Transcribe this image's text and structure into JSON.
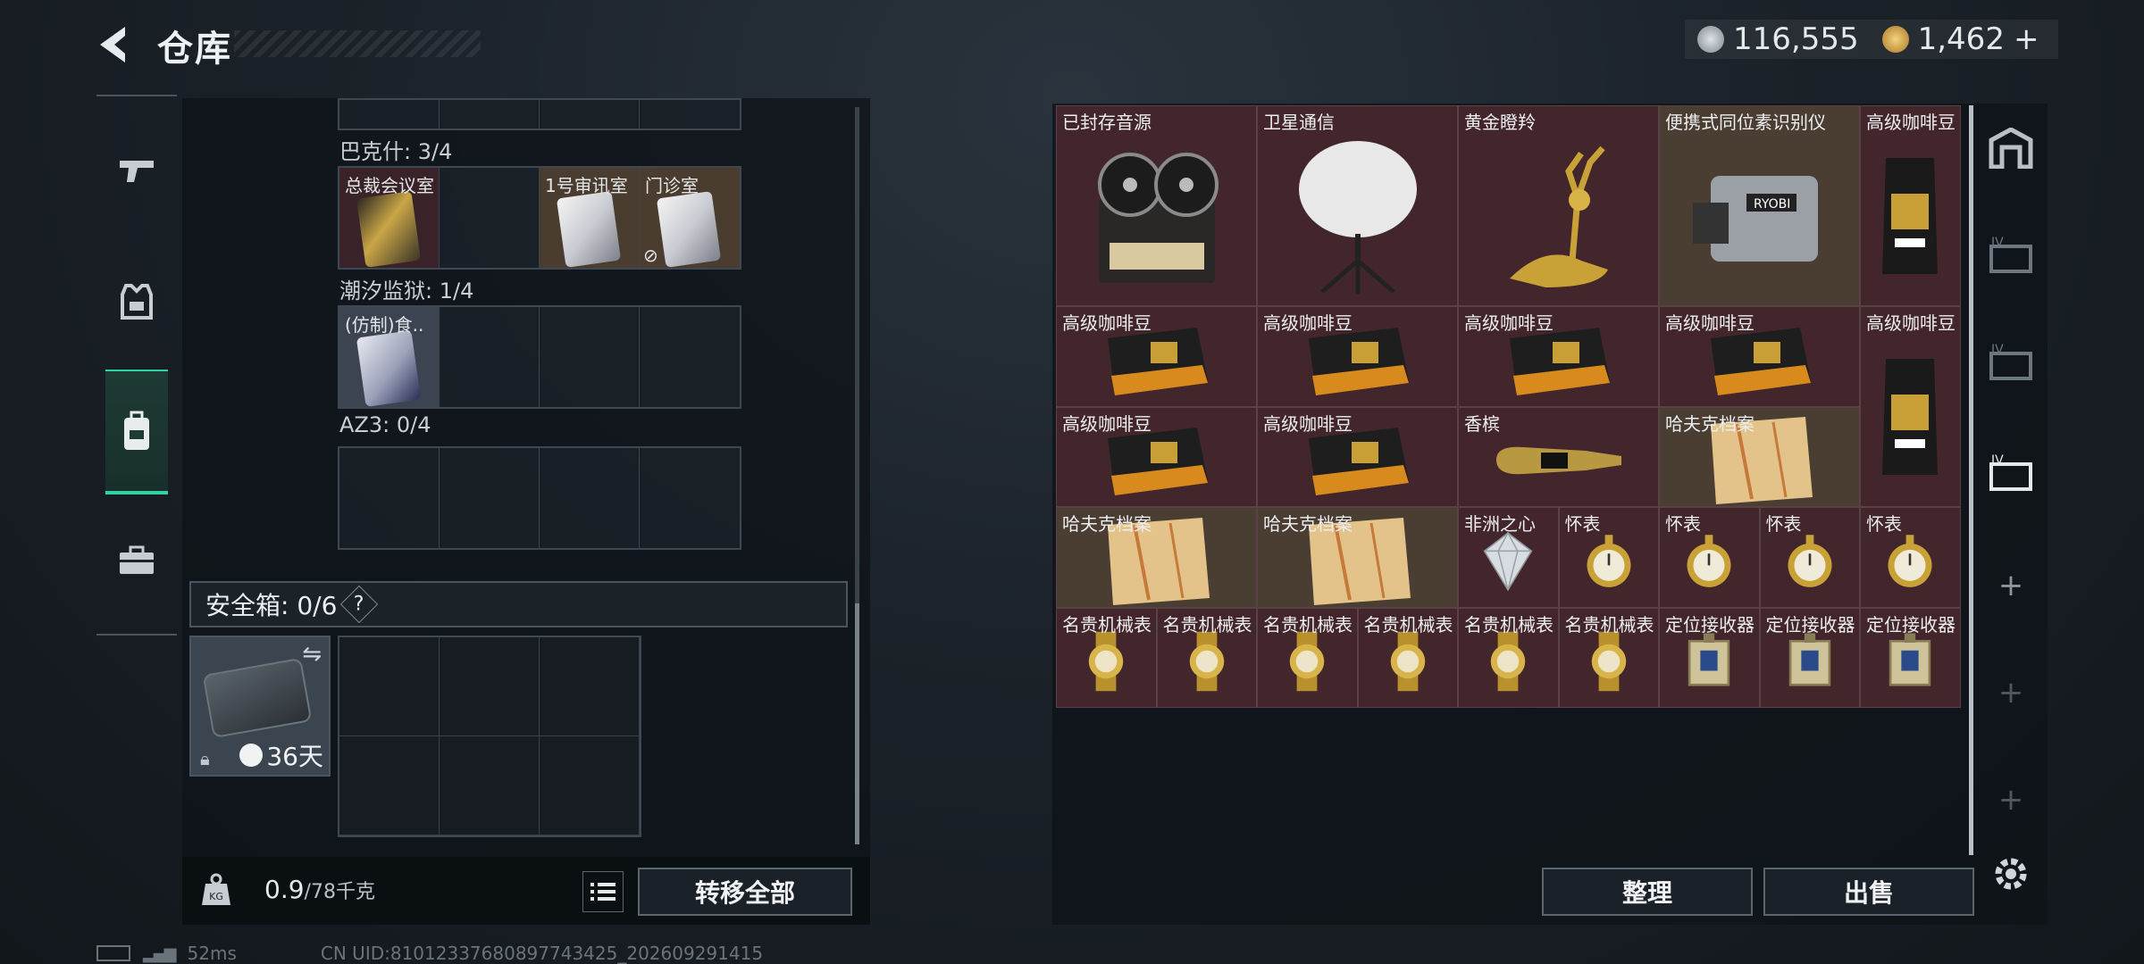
{
  "header": {
    "title": "仓库"
  },
  "currency": {
    "silver_value": "116,555",
    "gold_value": "1,462",
    "gold_plus": "+"
  },
  "left_nav": [
    "gun-icon",
    "armor-icon",
    "backpack-icon",
    "briefcase-icon"
  ],
  "keycards": {
    "section1": {
      "label": "巴克什: 3/4",
      "slots": [
        "总裁会议室",
        "",
        "1号审讯室",
        "门诊室"
      ]
    },
    "section2": {
      "label": "潮汐监狱: 1/4",
      "slots": [
        "(仿制)食..",
        "",
        "",
        ""
      ]
    },
    "section3": {
      "label": "AZ3: 0/4",
      "slots": [
        "",
        "",
        "",
        ""
      ]
    }
  },
  "safe": {
    "label": "安全箱: 0/6",
    "help": "?",
    "days": "36天"
  },
  "weight": {
    "current": "0.9",
    "max": "/78千克"
  },
  "buttons": {
    "transfer_all": "转移全部",
    "sort": "整理",
    "sell": "出售"
  },
  "items": [
    {
      "name": "已封存音源",
      "icon": "reel-recorder-icon",
      "bg": "red"
    },
    {
      "name": "卫星通信",
      "icon": "satellite-dish-icon",
      "bg": "red"
    },
    {
      "name": "黄金瞪羚",
      "icon": "gold-gazelle-icon",
      "bg": "red"
    },
    {
      "name": "便携式同位素识别仪",
      "icon": "isotope-scanner-icon",
      "bg": "tan"
    },
    {
      "name": "高级咖啡豆",
      "icon": "coffee-bag-icon",
      "bg": "red"
    },
    {
      "name": "高级咖啡豆",
      "icon": "coffee-pack-icon",
      "bg": "red"
    },
    {
      "name": "高级咖啡豆",
      "icon": "coffee-pack-icon",
      "bg": "red"
    },
    {
      "name": "高级咖啡豆",
      "icon": "coffee-pack-icon",
      "bg": "red"
    },
    {
      "name": "高级咖啡豆",
      "icon": "coffee-pack-icon",
      "bg": "red"
    },
    {
      "name": "高级咖啡豆",
      "icon": "coffee-bag-icon",
      "bg": "red"
    },
    {
      "name": "高级咖啡豆",
      "icon": "coffee-pack-icon",
      "bg": "red"
    },
    {
      "name": "高级咖啡豆",
      "icon": "coffee-pack-icon",
      "bg": "red"
    },
    {
      "name": "香槟",
      "icon": "champagne-icon",
      "bg": "red"
    },
    {
      "name": "哈夫克档案",
      "icon": "dossier-icon",
      "bg": "tan"
    },
    {
      "name": "哈夫克档案",
      "icon": "dossier-icon",
      "bg": "tan"
    },
    {
      "name": "哈夫克档案",
      "icon": "dossier-icon",
      "bg": "tan"
    },
    {
      "name": "非洲之心",
      "icon": "diamond-icon",
      "bg": "red"
    },
    {
      "name": "怀表",
      "icon": "pocket-watch-icon",
      "bg": "red"
    },
    {
      "name": "怀表",
      "icon": "pocket-watch-icon",
      "bg": "red"
    },
    {
      "name": "怀表",
      "icon": "pocket-watch-icon",
      "bg": "red"
    },
    {
      "name": "怀表",
      "icon": "pocket-watch-icon",
      "bg": "red"
    },
    {
      "name": "名贵机械表",
      "icon": "gold-watch-icon",
      "bg": "red"
    },
    {
      "name": "名贵机械表",
      "icon": "gold-watch-icon",
      "bg": "red"
    },
    {
      "name": "名贵机械表",
      "icon": "gold-watch-icon",
      "bg": "red"
    },
    {
      "name": "名贵机械表",
      "icon": "gold-watch-icon",
      "bg": "red"
    },
    {
      "name": "名贵机械表",
      "icon": "gold-watch-icon",
      "bg": "red"
    },
    {
      "name": "名贵机械表",
      "icon": "gold-watch-icon",
      "bg": "red"
    },
    {
      "name": "定位接收器",
      "icon": "gps-receiver-icon",
      "bg": "red"
    },
    {
      "name": "定位接收器",
      "icon": "gps-receiver-icon",
      "bg": "red"
    },
    {
      "name": "定位接收器",
      "icon": "gps-receiver-icon",
      "bg": "red"
    }
  ],
  "right_tabs": [
    "vault-icon",
    "container-iv-icon",
    "container-iv-icon",
    "container-iv-active-icon",
    "add-tab-icon",
    "add-tab-icon",
    "add-tab-icon"
  ],
  "status": {
    "ping": "52ms",
    "uid": "CN UID:81012337680897743425_202609291415"
  },
  "colors": {
    "accent": "#2fd1a5",
    "item_red": "#43262c",
    "item_tan": "#4a3d32"
  }
}
